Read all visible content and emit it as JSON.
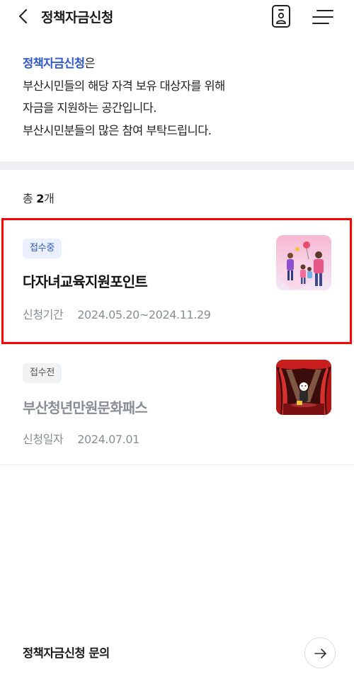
{
  "header": {
    "title": "정책자금신청",
    "back_icon": "chevron-left-icon",
    "id_icon": "id-card-icon",
    "menu_icon": "hamburger-menu-icon"
  },
  "intro": {
    "highlight": "정책자금신청",
    "suffix": "은",
    "lines": [
      "부산시민들의 해당 자격 보유 대상자를 위해",
      "자금을 지원하는 공간입니다.",
      "부산시민분들의 많은 참여 부탁드립니다."
    ]
  },
  "list": {
    "count_prefix": "총 ",
    "count_value": "2",
    "count_suffix": "개",
    "items": [
      {
        "badge": "접수중",
        "title": "다자녀교육지원포인트",
        "meta_label": "신청기간",
        "meta_value": "2024.05.20~2024.11.29",
        "thumb": "family-illustration"
      },
      {
        "badge": "접수전",
        "title": "부산청년만원문화패스",
        "meta_label": "신청일자",
        "meta_value": "2024.07.01",
        "thumb": "theater-stage-illustration"
      }
    ]
  },
  "footer": {
    "inquiry_label": "정책자금신청 문의",
    "arrow_icon": "arrow-right-icon"
  },
  "colors": {
    "accent": "#2f57c7",
    "highlight_border": "#ff0000",
    "muted": "#8a8d93"
  }
}
